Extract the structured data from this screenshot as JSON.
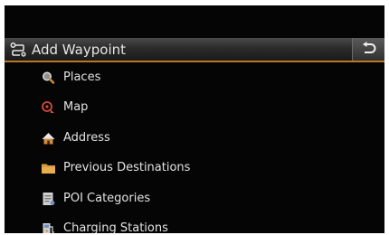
{
  "header": {
    "title": "Add Waypoint",
    "title_icon": "add-waypoint-icon",
    "back_icon": "back-arrow-icon"
  },
  "menu": {
    "items": [
      {
        "label": "Places",
        "icon": "magnifier-icon"
      },
      {
        "label": "Map",
        "icon": "map-pin-icon"
      },
      {
        "label": "Address",
        "icon": "house-icon"
      },
      {
        "label": "Previous Destinations",
        "icon": "folder-icon"
      },
      {
        "label": "POI Categories",
        "icon": "poi-document-icon"
      },
      {
        "label": "Charging Stations",
        "icon": "charging-station-icon"
      }
    ]
  },
  "colors": {
    "background": "#050505",
    "accent": "#b9772a",
    "text": "#e2e2e2"
  }
}
